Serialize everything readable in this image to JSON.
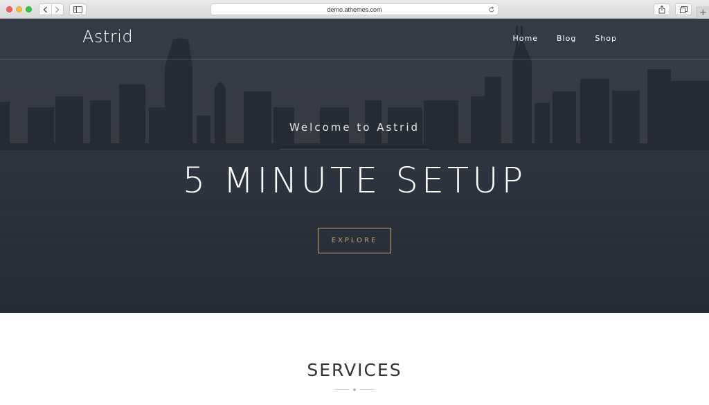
{
  "browser": {
    "url": "demo.athemes.com",
    "newtab_label": "+"
  },
  "header": {
    "logo": "Astrid",
    "menu": [
      "Home",
      "Blog",
      "Shop"
    ]
  },
  "hero": {
    "welcome": "Welcome to Astrid",
    "headline": "5 MINUTE SETUP",
    "button": "EXPLORE"
  },
  "services": {
    "title": "SERVICES"
  },
  "colors": {
    "accent": "#c5a46d",
    "hero_overlay": "#2e3540"
  }
}
